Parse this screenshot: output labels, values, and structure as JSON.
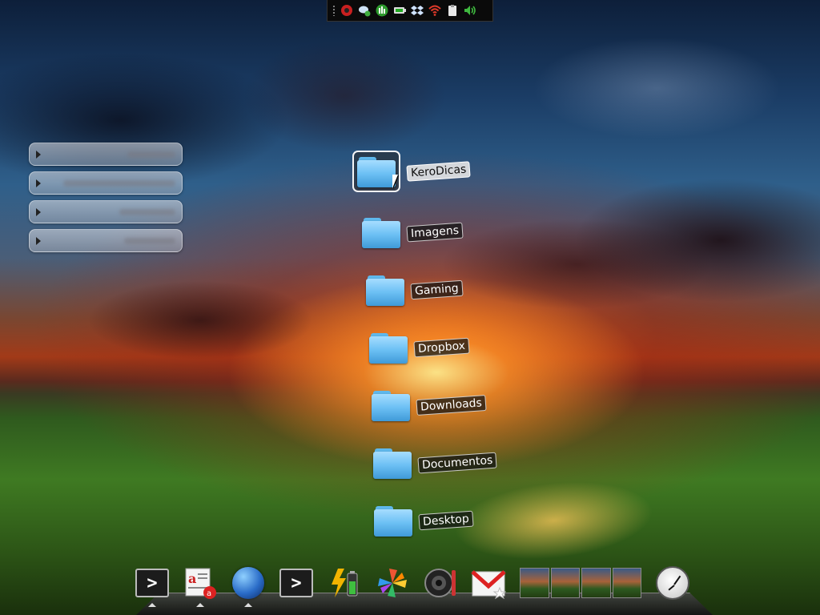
{
  "top_panel": {
    "tray_icons": [
      "antivirus-icon",
      "chat-icon",
      "system-monitor-icon",
      "battery-icon",
      "dropbox-icon",
      "wifi-icon",
      "clipboard-icon",
      "volume-icon"
    ]
  },
  "widget_list": {
    "rows": [
      {
        "label": ""
      },
      {
        "label": ""
      },
      {
        "label": ""
      },
      {
        "label": ""
      }
    ]
  },
  "desktop": {
    "folders": [
      {
        "label": "KeroDicas",
        "selected": true
      },
      {
        "label": "Imagens"
      },
      {
        "label": "Gaming"
      },
      {
        "label": "Dropbox"
      },
      {
        "label": "Downloads"
      },
      {
        "label": "Documentos"
      },
      {
        "label": "Desktop"
      }
    ]
  },
  "dock": {
    "items": [
      {
        "name": "terminal-icon",
        "glyph": ">"
      },
      {
        "name": "text-editor-icon"
      },
      {
        "name": "browser-globe-icon"
      },
      {
        "name": "terminal-icon",
        "glyph": ">"
      },
      {
        "name": "power-battery-icon"
      },
      {
        "name": "pinwheel-app-icon"
      },
      {
        "name": "speaker-icon"
      },
      {
        "name": "gmail-icon"
      },
      {
        "name": "workspace-switcher"
      },
      {
        "name": "clock-icon"
      }
    ]
  },
  "colors": {
    "folder_blue": "#6cc0f4",
    "panel_bg": "#0a0a0a"
  }
}
